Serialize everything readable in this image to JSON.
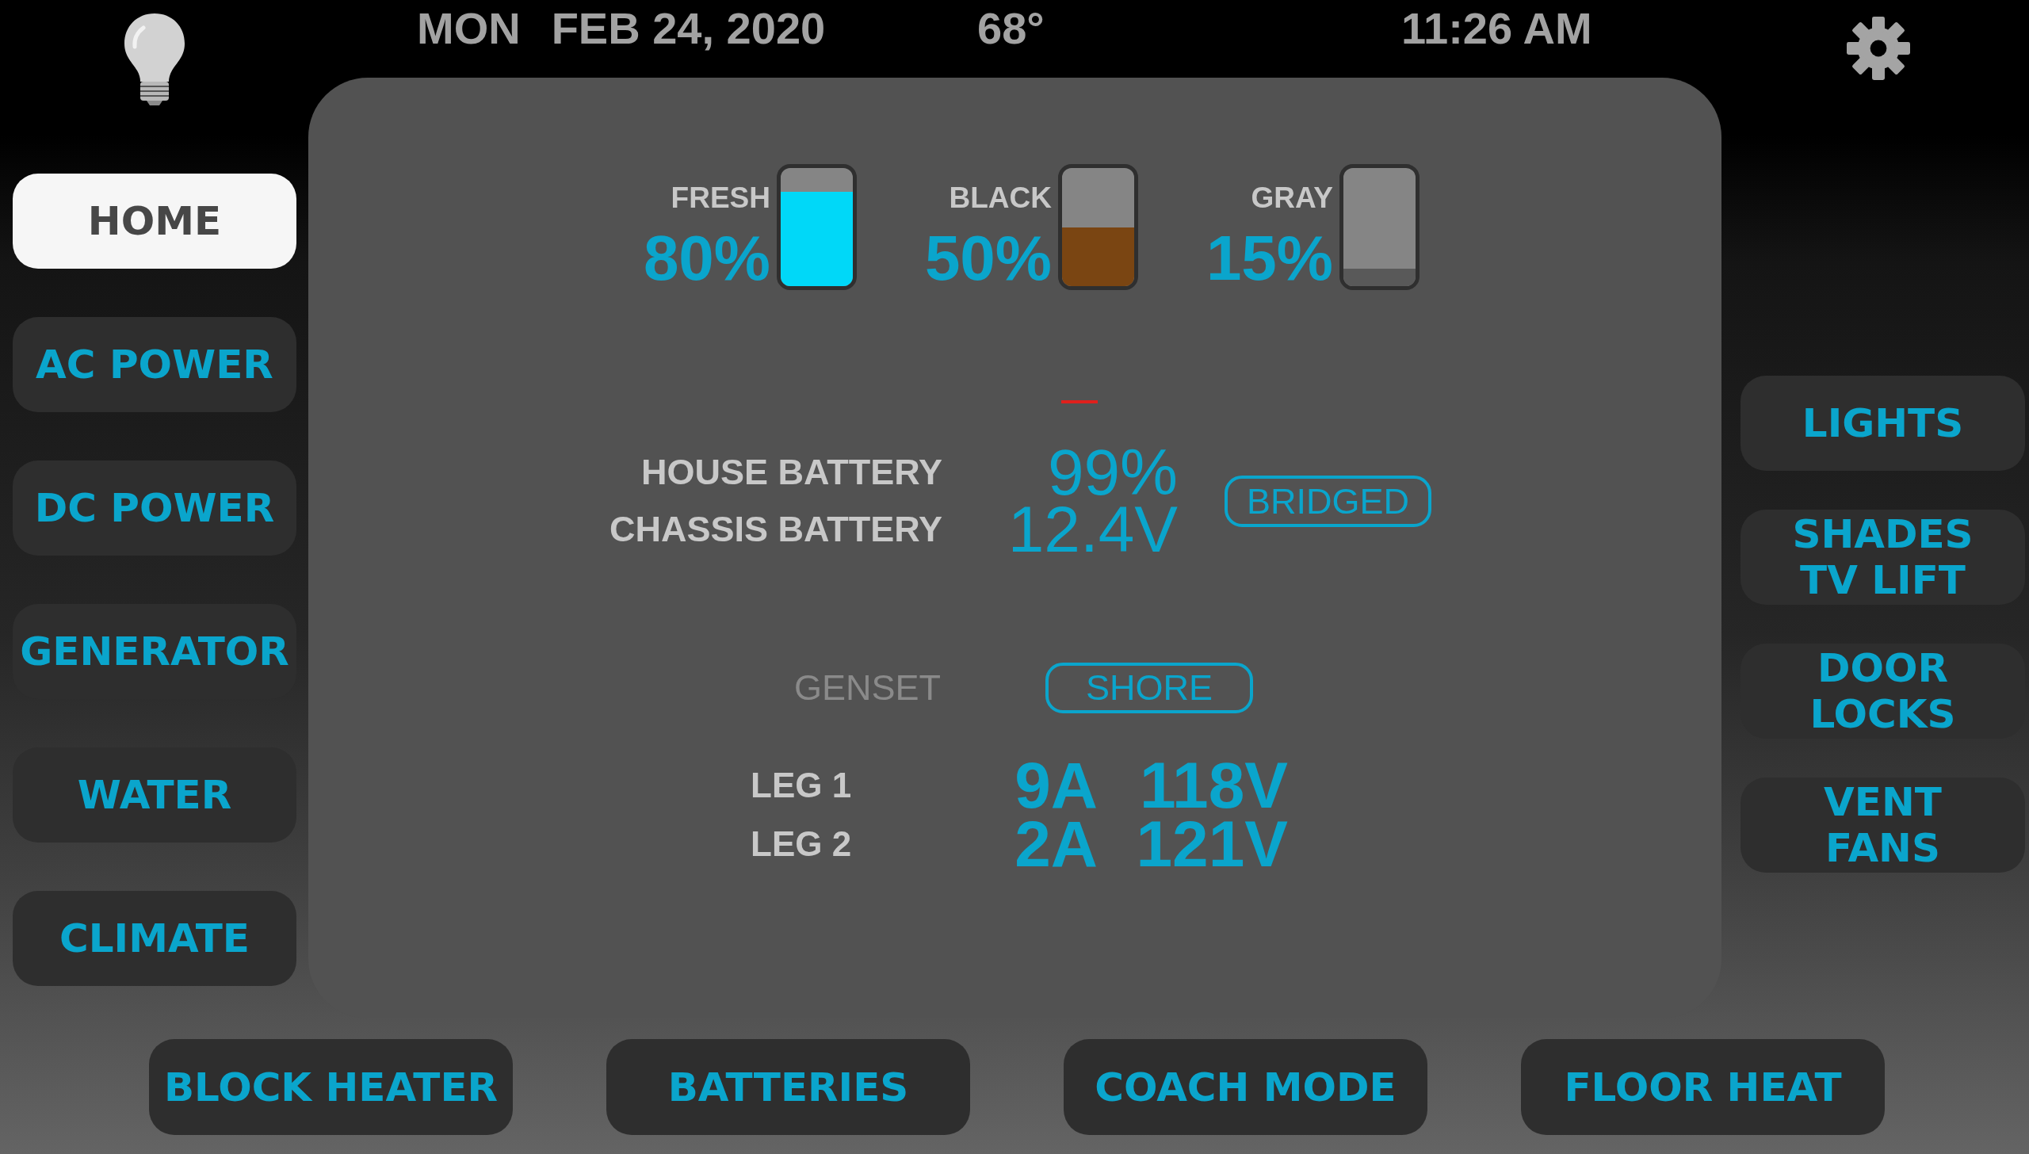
{
  "status_bar": {
    "day": "MON",
    "date": "FEB 24, 2020",
    "temperature": "68°",
    "time": "11:26 AM"
  },
  "sidebar_left": [
    {
      "label": "HOME",
      "selected": true
    },
    {
      "label": "AC POWER",
      "selected": false
    },
    {
      "label": "DC POWER",
      "selected": false
    },
    {
      "label": "GENERATOR",
      "selected": false
    },
    {
      "label": "WATER",
      "selected": false
    },
    {
      "label": "CLIMATE",
      "selected": false
    }
  ],
  "tanks": [
    {
      "label": "FRESH",
      "reading": "80%",
      "level": 0.8,
      "color": "#00d8f8"
    },
    {
      "label": "BLACK",
      "reading": "50%",
      "level": 0.5,
      "color": "#7a4512"
    },
    {
      "label": "GRAY",
      "reading": "15%",
      "level": 0.15,
      "color": "#595959"
    }
  ],
  "batteries": [
    {
      "label": "HOUSE BATTERY",
      "reading": "99%"
    },
    {
      "label": "CHASSIS BATTERY",
      "reading": "12.4V"
    }
  ],
  "bridge_status": "BRIDGED",
  "power_sources": [
    {
      "label": "GENSET",
      "selected": false
    },
    {
      "label": "SHORE",
      "selected": true
    }
  ],
  "legs": [
    {
      "label": "LEG 1",
      "current": "9A",
      "voltage": "118V"
    },
    {
      "label": "LEG 2",
      "current": "2A",
      "voltage": "121V"
    }
  ],
  "sidebar_right": [
    {
      "lines": [
        "LIGHTS"
      ],
      "selected": false
    },
    {
      "lines": [
        "SHADES",
        "TV LIFT"
      ],
      "selected": false
    },
    {
      "lines": [
        "DOOR",
        "LOCKS"
      ],
      "selected": false
    },
    {
      "lines": [
        "VENT",
        "FANS"
      ],
      "selected": false
    }
  ],
  "bottom_bar": [
    {
      "label": "BLOCK HEATER",
      "selected": false
    },
    {
      "label": "BATTERIES",
      "selected": false
    },
    {
      "label": "COACH MODE",
      "selected": false
    },
    {
      "label": "FLOOR HEAT",
      "selected": false
    }
  ]
}
